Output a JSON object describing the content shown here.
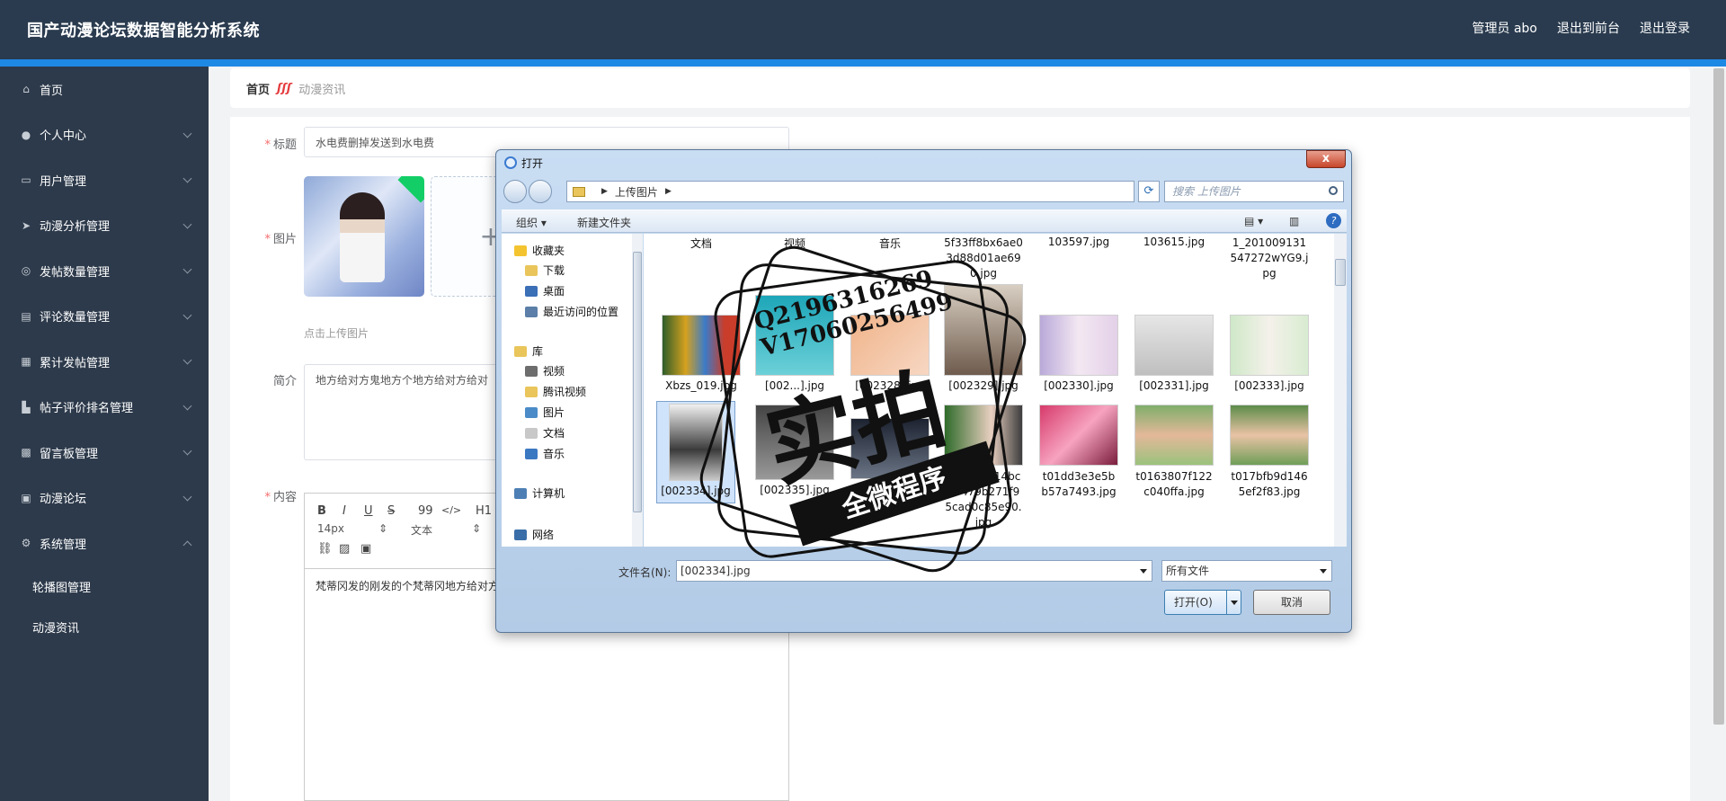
{
  "app": {
    "title": "国产动漫论坛数据智能分析系统",
    "top_links": [
      "管理员 abo",
      "退出到前台",
      "退出登录"
    ]
  },
  "sidebar": {
    "items": [
      {
        "label": "首页",
        "icon": "home-icon",
        "has_chevron": false
      },
      {
        "label": "个人中心",
        "icon": "user-icon",
        "has_chevron": true
      },
      {
        "label": "用户管理",
        "icon": "chat-icon",
        "has_chevron": true
      },
      {
        "label": "动漫分析管理",
        "icon": "send-icon",
        "has_chevron": true
      },
      {
        "label": "发帖数量管理",
        "icon": "target-icon",
        "has_chevron": true
      },
      {
        "label": "评论数量管理",
        "icon": "briefcase-icon",
        "has_chevron": true
      },
      {
        "label": "累计发帖管理",
        "icon": "clipboard-icon",
        "has_chevron": true
      },
      {
        "label": "帖子评价排名管理",
        "icon": "factory-icon",
        "has_chevron": true
      },
      {
        "label": "留言板管理",
        "icon": "grid-icon",
        "has_chevron": true
      },
      {
        "label": "动漫论坛",
        "icon": "browser-icon",
        "has_chevron": true
      },
      {
        "label": "系统管理",
        "icon": "settings-icon",
        "has_chevron": true
      }
    ],
    "subitems": [
      "轮播图管理",
      "动漫资讯"
    ]
  },
  "breadcrumb": {
    "home": "首页",
    "separator": "ʃʃʃ",
    "current": "动漫资讯"
  },
  "form": {
    "title_label": "标题",
    "title_value": "水电费删掉发送到水电费",
    "image_label": "图片",
    "upload_tip": "点击上传图片",
    "plus": "+",
    "intro_label": "简介",
    "intro_value": "地方给对方鬼地方个地方给对方给对",
    "content_label": "内容",
    "content_value": "梵蒂冈发的刚发的个梵蒂冈地方给对方",
    "editor": {
      "buttons": [
        "B",
        "I",
        "U",
        "S",
        "99",
        "</>",
        "H1"
      ],
      "font_size": "14px",
      "text_type": "文本"
    }
  },
  "dialog": {
    "title": "打开",
    "close": "x",
    "path": "上传图片",
    "search_placeholder": "搜索 上传图片",
    "organize": "组织 ▾",
    "new_folder": "新建文件夹",
    "help": "?",
    "nav": {
      "favorites": "收藏夹",
      "fav_items": [
        "下载",
        "桌面",
        "最近访问的位置"
      ],
      "libraries": "库",
      "lib_items": [
        "视频",
        "腾讯视频",
        "图片",
        "文档",
        "音乐"
      ],
      "computer": "计算机",
      "network": "网络"
    },
    "top_row": [
      "文档",
      "视频",
      "音乐",
      "5f33ff8bx6ae03d88d01ae690.jpg",
      "103597.jpg",
      "103615.jpg",
      "1_201009131547272wYG9.jpg"
    ],
    "row2": [
      "Xbzs_019.jpg",
      "[002...].jpg",
      "[002328].jpg",
      "[002329].jpg",
      "[002330].jpg",
      "[002331].jpg",
      "[002333].jpg"
    ],
    "row3": [
      "[002334].jpg",
      "[002335].jpg",
      "[002336].jpg",
      "1a8d36d14bc75479b271f95cad0c85e90.jpg",
      "t01dd3e3e5bb57a7493.jpg",
      "t0163807f122c040ffa.jpg",
      "t017bfb9d1465ef2f83.jpg"
    ],
    "filename_label": "文件名(N):",
    "filename_value": "[002334].jpg",
    "filetype": "所有文件",
    "open_btn": "打开(O)",
    "cancel_btn": "取消"
  },
  "watermark": {
    "line1": "Q2196316269",
    "line2": "V17060256499",
    "big": "实拍",
    "band": "全微程序"
  }
}
